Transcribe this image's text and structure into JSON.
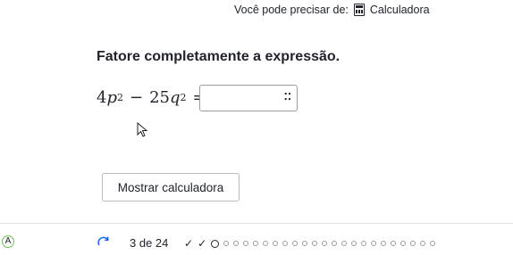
{
  "hint": {
    "prefix": "Você pode precisar de:",
    "calculator_link": "Calculadora",
    "icon": "calculator-icon"
  },
  "question": {
    "title": "Fatore completamente a expressão.",
    "expr_a_coef": "4",
    "expr_a_var": "p",
    "expr_a_exp": "2",
    "expr_minus": "−",
    "expr_b_coef": "25",
    "expr_b_var": "q",
    "expr_b_exp": "2",
    "expr_equals": "=",
    "answer_value": "",
    "keyboard_icon": "math-keyboard-icon"
  },
  "actions": {
    "show_calculator": "Mostrar calculadora"
  },
  "footer": {
    "avatar_letter": "A",
    "progress_label": "3 de 24",
    "completed_count": 2,
    "total_dots": 23
  }
}
